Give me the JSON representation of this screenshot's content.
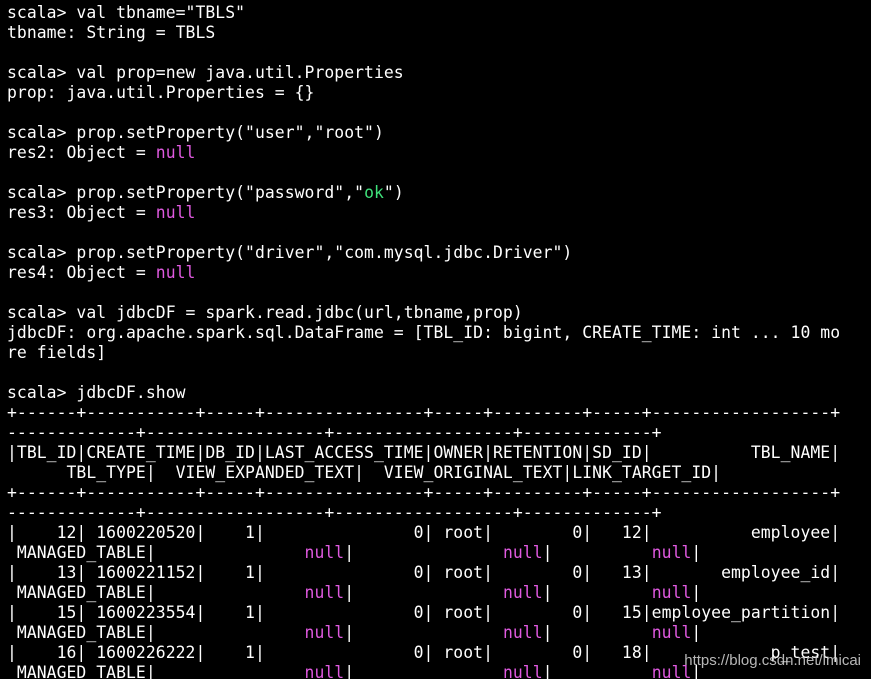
{
  "colors": {
    "background": "#000000",
    "text": "#ffffff",
    "null_keyword": "#e05ae0",
    "string_literal": "#3fe07a",
    "watermark": "#d8d8d8"
  },
  "terminal": {
    "lines": [
      [
        {
          "t": "scala> val tbname=\"TBLS\"",
          "c": "plain"
        }
      ],
      [
        {
          "t": "tbname: String = TBLS",
          "c": "plain"
        }
      ],
      [
        {
          "t": "",
          "c": "plain"
        }
      ],
      [
        {
          "t": "scala> val prop=new java.util.Properties",
          "c": "plain"
        }
      ],
      [
        {
          "t": "prop: java.util.Properties = {}",
          "c": "plain"
        }
      ],
      [
        {
          "t": "",
          "c": "plain"
        }
      ],
      [
        {
          "t": "scala> prop.setProperty(\"user\",\"root\")",
          "c": "plain"
        }
      ],
      [
        {
          "t": "res2: Object = ",
          "c": "plain"
        },
        {
          "t": "null",
          "c": "null"
        }
      ],
      [
        {
          "t": "",
          "c": "plain"
        }
      ],
      [
        {
          "t": "scala> prop.setProperty(\"password\",\"",
          "c": "plain"
        },
        {
          "t": "ok",
          "c": "str"
        },
        {
          "t": "\")",
          "c": "plain"
        }
      ],
      [
        {
          "t": "res3: Object = ",
          "c": "plain"
        },
        {
          "t": "null",
          "c": "null"
        }
      ],
      [
        {
          "t": "",
          "c": "plain"
        }
      ],
      [
        {
          "t": "scala> prop.setProperty(\"driver\",\"com.mysql.jdbc.Driver\")",
          "c": "plain"
        }
      ],
      [
        {
          "t": "res4: Object = ",
          "c": "plain"
        },
        {
          "t": "null",
          "c": "null"
        }
      ],
      [
        {
          "t": "",
          "c": "plain"
        }
      ],
      [
        {
          "t": "scala> val jdbcDF = spark.read.jdbc(url,tbname,prop)",
          "c": "plain"
        }
      ],
      [
        {
          "t": "jdbcDF: org.apache.spark.sql.DataFrame = [TBL_ID: bigint, CREATE_TIME: int ... 10 mo",
          "c": "plain"
        }
      ],
      [
        {
          "t": "re fields]",
          "c": "plain"
        }
      ],
      [
        {
          "t": "",
          "c": "plain"
        }
      ],
      [
        {
          "t": "scala> jdbcDF.show",
          "c": "plain"
        }
      ],
      [
        {
          "t": "+------+-----------+-----+----------------+-----+---------+-----+------------------+",
          "c": "plain"
        }
      ],
      [
        {
          "t": "-------------+------------------+------------------+-------------+",
          "c": "plain"
        }
      ],
      [
        {
          "t": "|TBL_ID|CREATE_TIME|DB_ID|LAST_ACCESS_TIME|OWNER|RETENTION|SD_ID|          TBL_NAME|",
          "c": "plain"
        }
      ],
      [
        {
          "t": "      TBL_TYPE|  VIEW_EXPANDED_TEXT|  VIEW_ORIGINAL_TEXT|LINK_TARGET_ID|",
          "c": "plain"
        }
      ],
      [
        {
          "t": "+------+-----------+-----+----------------+-----+---------+-----+------------------+",
          "c": "plain"
        }
      ],
      [
        {
          "t": "-------------+------------------+------------------+-------------+",
          "c": "plain"
        }
      ],
      [
        {
          "t": "|    12| 1600220520|    1|               0| root|        0|   12|          employee|",
          "c": "plain"
        }
      ],
      [
        {
          "t": " MANAGED_TABLE|               ",
          "c": "plain"
        },
        {
          "t": "null",
          "c": "null"
        },
        {
          "t": "|               ",
          "c": "plain"
        },
        {
          "t": "null",
          "c": "null"
        },
        {
          "t": "|          ",
          "c": "plain"
        },
        {
          "t": "null",
          "c": "null"
        },
        {
          "t": "|",
          "c": "plain"
        }
      ],
      [
        {
          "t": "|    13| 1600221152|    1|               0| root|        0|   13|       employee_id|",
          "c": "plain"
        }
      ],
      [
        {
          "t": " MANAGED_TABLE|               ",
          "c": "plain"
        },
        {
          "t": "null",
          "c": "null"
        },
        {
          "t": "|               ",
          "c": "plain"
        },
        {
          "t": "null",
          "c": "null"
        },
        {
          "t": "|          ",
          "c": "plain"
        },
        {
          "t": "null",
          "c": "null"
        },
        {
          "t": "|",
          "c": "plain"
        }
      ],
      [
        {
          "t": "|    15| 1600223554|    1|               0| root|        0|   15|employee_partition|",
          "c": "plain"
        }
      ],
      [
        {
          "t": " MANAGED_TABLE|               ",
          "c": "plain"
        },
        {
          "t": "null",
          "c": "null"
        },
        {
          "t": "|               ",
          "c": "plain"
        },
        {
          "t": "null",
          "c": "null"
        },
        {
          "t": "|          ",
          "c": "plain"
        },
        {
          "t": "null",
          "c": "null"
        },
        {
          "t": "|",
          "c": "plain"
        }
      ],
      [
        {
          "t": "|    16| 1600226222|    1|               0| root|        0|   18|            p_test|",
          "c": "plain"
        }
      ],
      [
        {
          "t": " MANAGED_TABLE|               ",
          "c": "plain"
        },
        {
          "t": "null",
          "c": "null"
        },
        {
          "t": "|               ",
          "c": "plain"
        },
        {
          "t": "null",
          "c": "null"
        },
        {
          "t": "|          ",
          "c": "plain"
        },
        {
          "t": "null",
          "c": "null"
        },
        {
          "t": "|",
          "c": "plain"
        }
      ]
    ]
  },
  "watermark": {
    "text": "https://blog.csdn.net/lmicai"
  }
}
